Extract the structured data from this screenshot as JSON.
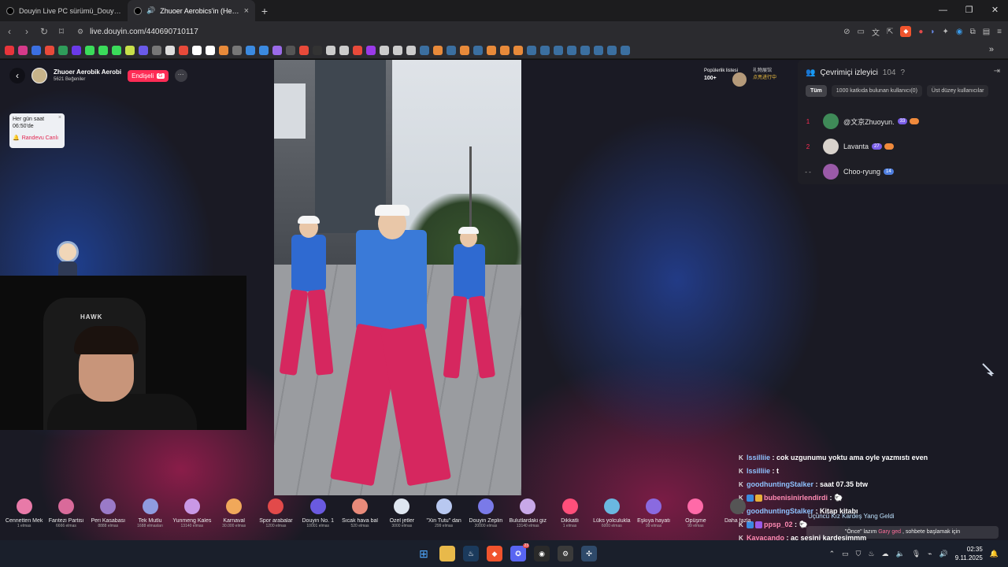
{
  "browser": {
    "tabs": [
      {
        "title": "Douyin Live PC sürümü_Douyin Live",
        "active": false
      },
      {
        "title": "Zhuoer Aerobics'in (Hejiangti",
        "active": true
      }
    ],
    "url": "live.douyin.com/440690710117",
    "new_tab": "+",
    "window_controls": [
      "—",
      "❐",
      "✕"
    ]
  },
  "streamer": {
    "name": "Zhuoer Aerobik Aerobi",
    "likes": "5621 Beğeniler",
    "follow_label": "Endişeli",
    "follow_badge": "G",
    "more": "···"
  },
  "reminder": {
    "line1": "Her gün saat",
    "line2": "06:50'de",
    "close": "×",
    "appointment": "Randevu Canlı"
  },
  "popularity": {
    "label": "Popülerlik listesi",
    "value": "100+",
    "gift_line1": "礼物展馆",
    "gift_line2": "点亮进行中"
  },
  "webcam": {
    "chair_logo": "HAWK"
  },
  "viewers": {
    "title": "Çevrimiçi izleyici",
    "count": "104",
    "help": "?",
    "exit_icon": "⇥",
    "tabs": [
      {
        "label": "Tüm",
        "active": true
      },
      {
        "label": "1000 katkıda bulunan kullanıcı(0)",
        "active": false
      },
      {
        "label": "Üst düzey kullanıcılar",
        "active": false
      }
    ],
    "list": [
      {
        "rank": "1",
        "name": "@文京Zhuoyun.",
        "level": "33",
        "avatar_color": "#3f8a58"
      },
      {
        "rank": "2",
        "name": "Lavanta",
        "level": "27",
        "avatar_color": "#d8d2cc"
      },
      {
        "rank": "- -",
        "name": "Choo-ryung",
        "level": "14",
        "avatar_color": "#9a5aa8"
      }
    ]
  },
  "chat": {
    "messages": [
      {
        "user": "lssilliie",
        "text": ": cok uzgunumu yoktu ama oyle yazmıstı even",
        "pink": false
      },
      {
        "user": "lssilliie",
        "text": ": t",
        "pink": false
      },
      {
        "user": "goodhuntingStalker",
        "text": ": saat 07.35 btw",
        "pink": false
      },
      {
        "user": "bubenisinirlendirdi",
        "text": ": 🐑",
        "pink": true
      },
      {
        "user": "goodhuntingStalker",
        "text": ": Kitap kitabı",
        "pink": false
      },
      {
        "user": "ppsp_02",
        "text": ": 🐑",
        "pink": true
      },
      {
        "user": "Kayacando",
        "text": ": aç sesini kardeşimmm",
        "pink": true
      }
    ],
    "entry_banner": "Üçüncü Kız Kardeş Yang Geldi",
    "hint_prefix": "\"Önce\" lazım",
    "hint_user": "Gary ged",
    "hint_suffix": ", sohbete başlamak için"
  },
  "gifts": [
    {
      "name": "Cennetten Mek",
      "price": "1 elmas",
      "color": "#e87aa8"
    },
    {
      "name": "Fantezi Partisi",
      "price": "6666 elmas",
      "color": "#d96a9a"
    },
    {
      "name": "Peri Kasabası",
      "price": "8888 elmas",
      "color": "#9a7ac8"
    },
    {
      "name": "Tek Mutlu",
      "price": "1688 elmasları",
      "color": "#8f9be0"
    },
    {
      "name": "Yunmeng Kales",
      "price": "13140 elmas",
      "color": "#c998e6"
    },
    {
      "name": "Karnaval",
      "price": "30.000 elmas",
      "color": "#f0a85a"
    },
    {
      "name": "Spor arabalar",
      "price": "1200 elmas",
      "color": "#e24a4a"
    },
    {
      "name": "Douyin No. 1",
      "price": "10001 elmas",
      "color": "#6a5ae0"
    },
    {
      "name": "Sıcak hava bal",
      "price": "520 elmas",
      "color": "#e88a7a"
    },
    {
      "name": "Özel jetler",
      "price": "3000 elmas",
      "color": "#dfe6f0"
    },
    {
      "name": "\"Xin Tutu\" dan",
      "price": "299 elmas",
      "color": "#b8c8f0"
    },
    {
      "name": "Douyin Zeplin",
      "price": "20000 elmas",
      "color": "#7a7ae8"
    },
    {
      "name": "Bulutlardaki giz",
      "price": "13140 elmas",
      "color": "#c8a8e8"
    },
    {
      "name": "Dikkatli",
      "price": "1 elmas",
      "color": "#ff4f7a"
    },
    {
      "name": "Lüks yolculukla",
      "price": "6000 elmas",
      "color": "#6ab8e0"
    },
    {
      "name": "Eşkıya hayatı",
      "price": "99 elmas",
      "color": "#8a6ae0"
    },
    {
      "name": "Öpüşme",
      "price": "99 elmas",
      "color": "#ff6aa8"
    },
    {
      "name": "Daha fazla",
      "price": "",
      "color": "#555"
    }
  ],
  "taskbar": {
    "time": "02:35",
    "date": "9.11.2025",
    "notify_count": "23"
  }
}
